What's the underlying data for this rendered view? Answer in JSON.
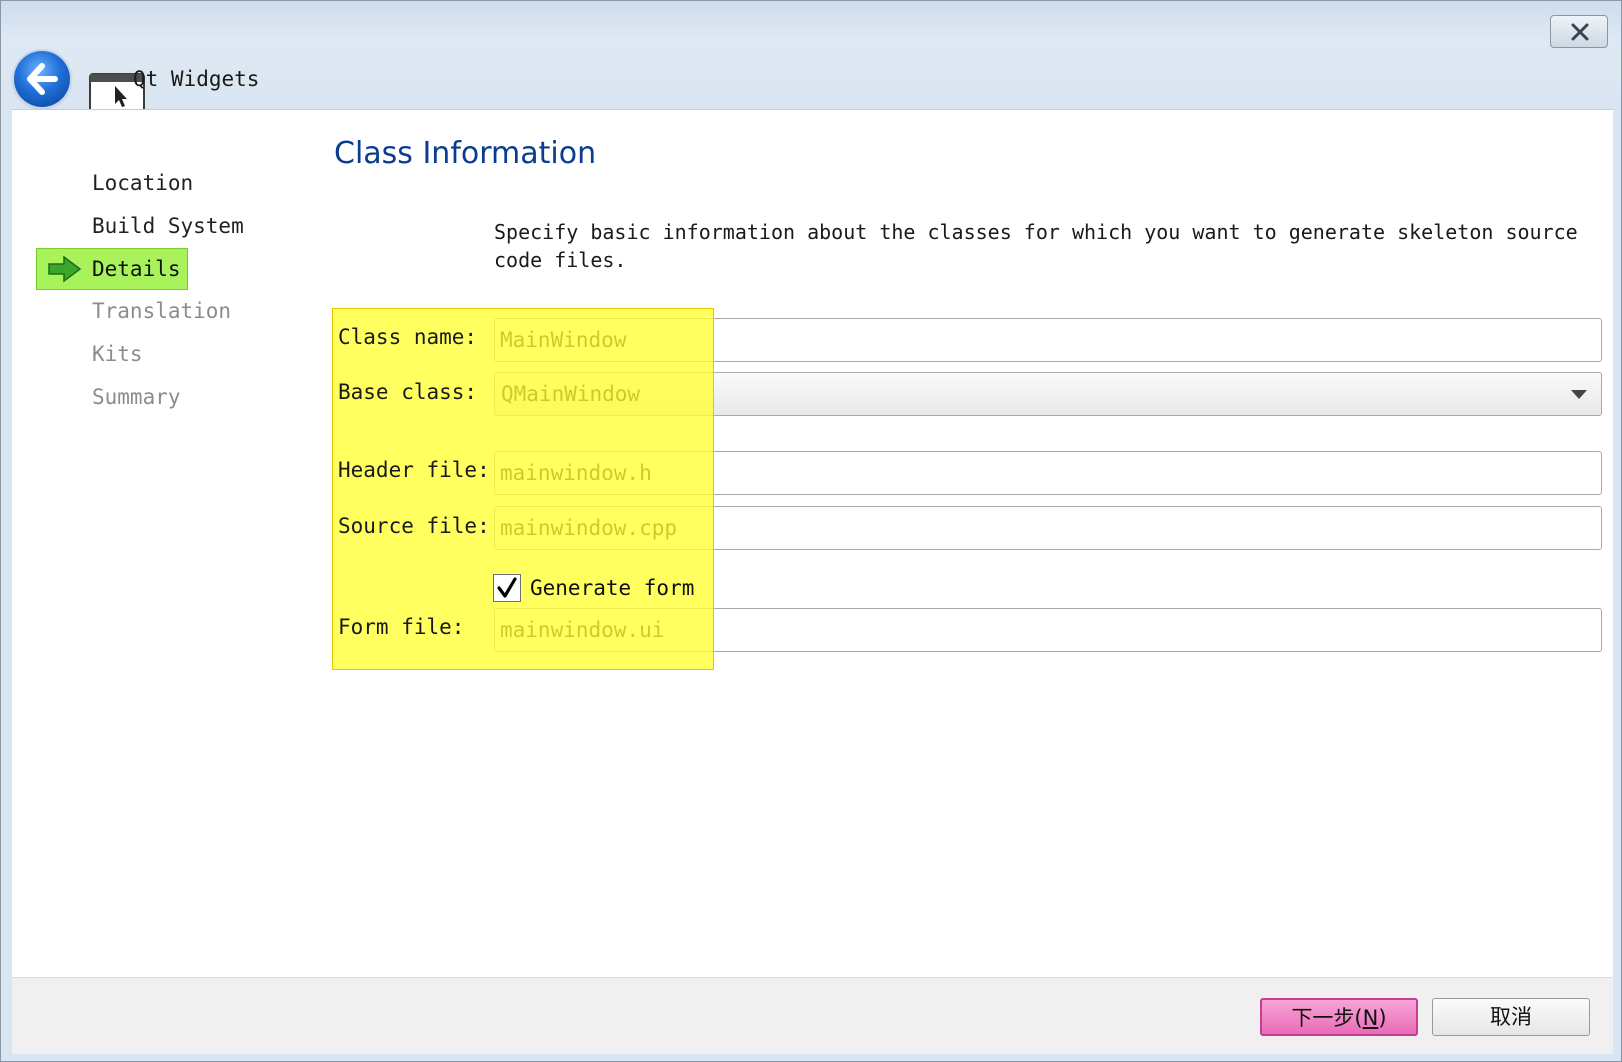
{
  "window": {
    "title": "Qt Widgets"
  },
  "nav": {
    "items": [
      {
        "label": "Location",
        "state": "done"
      },
      {
        "label": "Build System",
        "state": "done"
      },
      {
        "label": "Details",
        "state": "current"
      },
      {
        "label": "Translation",
        "state": "todo"
      },
      {
        "label": "Kits",
        "state": "todo"
      },
      {
        "label": "Summary",
        "state": "todo"
      }
    ]
  },
  "page": {
    "title": "Class Information",
    "description": "Specify basic information about the classes for which you want to generate skeleton source code files."
  },
  "form": {
    "class_name_label": "Class name:",
    "class_name_value": "MainWindow",
    "base_class_label": "Base class:",
    "base_class_value": "QMainWindow",
    "header_file_label": "Header file:",
    "header_file_value": "mainwindow.h",
    "source_file_label": "Source file:",
    "source_file_value": "mainwindow.cpp",
    "generate_form_label": "Generate form",
    "generate_form_checked": true,
    "form_file_label": "Form file:",
    "form_file_value": "mainwindow.ui"
  },
  "buttons": {
    "next_label": "下一步(",
    "next_mnemonic": "N",
    "next_suffix": ")",
    "cancel_label": "取消"
  },
  "colors": {
    "title_blue": "#0a3d91",
    "current_step_green": "#a8f25c",
    "highlight_yellow": "#ffff32",
    "next_button_pink": "#e96bb8"
  }
}
